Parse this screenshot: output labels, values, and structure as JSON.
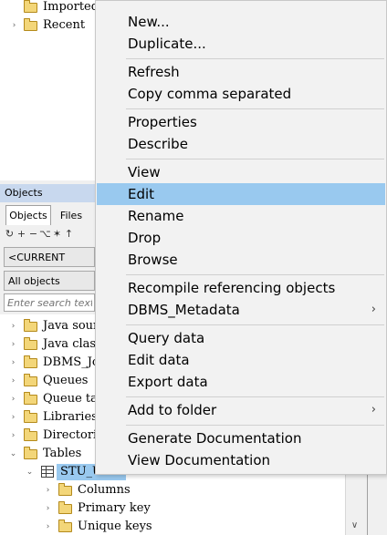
{
  "top_tree": {
    "items": [
      {
        "label": "Imported History",
        "expander": ""
      },
      {
        "label": "Recent",
        "expander": "›"
      }
    ]
  },
  "objects_panel": {
    "header": "Objects",
    "tabs": [
      {
        "label": "Objects"
      },
      {
        "label": "Files"
      }
    ],
    "toolbar_icons": [
      "refresh-icon",
      "add-icon",
      "remove-icon",
      "find-icon",
      "filter-icon",
      "up-icon"
    ],
    "user_select": "<CURRENT USER>",
    "object_filter": "All objects",
    "search_placeholder": "Enter search text..."
  },
  "bottom_tree": {
    "items": [
      {
        "label": "Java sources",
        "expander": "›"
      },
      {
        "label": "Java classes",
        "expander": "›"
      },
      {
        "label": "DBMS_Jobs",
        "expander": "›"
      },
      {
        "label": "Queues",
        "expander": "›"
      },
      {
        "label": "Queue tables",
        "expander": "›"
      },
      {
        "label": "Libraries",
        "expander": "›"
      },
      {
        "label": "Directories",
        "expander": "›"
      },
      {
        "label": "Tables",
        "expander": "⌄"
      },
      {
        "label": "STU_USER",
        "expander": "⌄"
      },
      {
        "label": "Columns",
        "expander": "›"
      },
      {
        "label": "Primary key",
        "expander": "›"
      },
      {
        "label": "Unique keys",
        "expander": "›"
      }
    ]
  },
  "context_menu": {
    "groups": [
      [
        {
          "label": "New..."
        },
        {
          "label": "Duplicate..."
        }
      ],
      [
        {
          "label": "Refresh"
        },
        {
          "label": "Copy comma separated"
        }
      ],
      [
        {
          "label": "Properties"
        },
        {
          "label": "Describe"
        }
      ],
      [
        {
          "label": "View"
        },
        {
          "label": "Edit",
          "highlighted": true
        },
        {
          "label": "Rename"
        },
        {
          "label": "Drop"
        },
        {
          "label": "Browse"
        }
      ],
      [
        {
          "label": "Recompile referencing objects"
        },
        {
          "label": "DBMS_Metadata",
          "submenu": true
        }
      ],
      [
        {
          "label": "Query data"
        },
        {
          "label": "Edit data"
        },
        {
          "label": "Export data"
        }
      ],
      [
        {
          "label": "Add to folder",
          "submenu": true
        }
      ],
      [
        {
          "label": "Generate Documentation"
        },
        {
          "label": "View Documentation"
        }
      ]
    ],
    "submenu_glyph": "›"
  },
  "colors": {
    "highlight": "#99c9ef",
    "menu_background": "#f2f2f2",
    "folder_fill": "#f3d679"
  }
}
